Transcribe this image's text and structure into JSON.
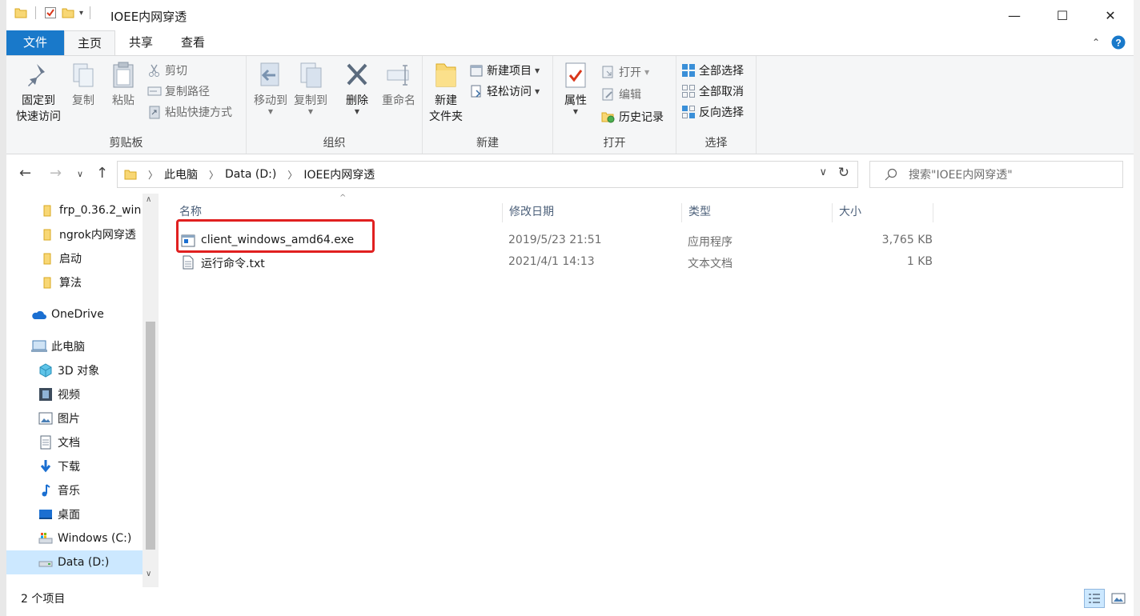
{
  "window": {
    "title": "IOEE内网穿透",
    "controls": {
      "minimize": "—",
      "maximize": "☐",
      "close": "✕"
    }
  },
  "tabs": {
    "file": "文件",
    "home": "主页",
    "share": "共享",
    "view": "查看"
  },
  "ribbon": {
    "clipboard": {
      "label": "剪贴板",
      "pin_line1": "固定到",
      "pin_line2": "快速访问",
      "copy": "复制",
      "paste": "粘贴",
      "cut": "剪切",
      "copy_path": "复制路径",
      "paste_shortcut": "粘贴快捷方式"
    },
    "organize": {
      "label": "组织",
      "move_to": "移动到",
      "copy_to": "复制到",
      "delete": "删除",
      "rename": "重命名"
    },
    "new": {
      "label": "新建",
      "new_folder_line1": "新建",
      "new_folder_line2": "文件夹",
      "new_item": "新建项目",
      "easy_access": "轻松访问"
    },
    "open": {
      "label": "打开",
      "properties": "属性",
      "open": "打开",
      "edit": "编辑",
      "history": "历史记录"
    },
    "select": {
      "label": "选择",
      "select_all": "全部选择",
      "select_none": "全部取消",
      "invert": "反向选择"
    }
  },
  "address": {
    "crumbs": [
      "此电脑",
      "Data (D:)",
      "IOEE内网穿透"
    ],
    "search_placeholder": "搜索\"IOEE内网穿透\""
  },
  "nav": {
    "items": [
      {
        "label": "frp_0.36.2_win",
        "icon": "folder-icon"
      },
      {
        "label": "ngrok内网穿透",
        "icon": "folder-icon"
      },
      {
        "label": "启动",
        "icon": "folder-icon"
      },
      {
        "label": "算法",
        "icon": "folder-icon"
      },
      {
        "label": "OneDrive",
        "icon": "cloud-icon"
      },
      {
        "label": "此电脑",
        "icon": "computer-icon"
      },
      {
        "label": "3D 对象",
        "icon": "cube-icon"
      },
      {
        "label": "视频",
        "icon": "video-icon"
      },
      {
        "label": "图片",
        "icon": "picture-icon"
      },
      {
        "label": "文档",
        "icon": "document-icon"
      },
      {
        "label": "下载",
        "icon": "download-icon"
      },
      {
        "label": "音乐",
        "icon": "music-icon"
      },
      {
        "label": "桌面",
        "icon": "desktop-icon"
      },
      {
        "label": "Windows (C:)",
        "icon": "drive-icon"
      },
      {
        "label": "Data (D:)",
        "icon": "drive-icon",
        "selected": true
      }
    ]
  },
  "files": {
    "columns": {
      "name": "名称",
      "date": "修改日期",
      "type": "类型",
      "size": "大小"
    },
    "rows": [
      {
        "name": "client_windows_amd64.exe",
        "date": "2019/5/23 21:51",
        "type": "应用程序",
        "size": "3,765 KB",
        "icon": "exe-icon",
        "highlighted": true
      },
      {
        "name": "运行命令.txt",
        "date": "2021/4/1 14:13",
        "type": "文本文档",
        "size": "1 KB",
        "icon": "txt-icon"
      }
    ]
  },
  "status": {
    "count": "2 个项目"
  },
  "colors": {
    "file_tab": "#1979ca",
    "selection": "#cce8ff",
    "highlight_box": "#e02020"
  }
}
